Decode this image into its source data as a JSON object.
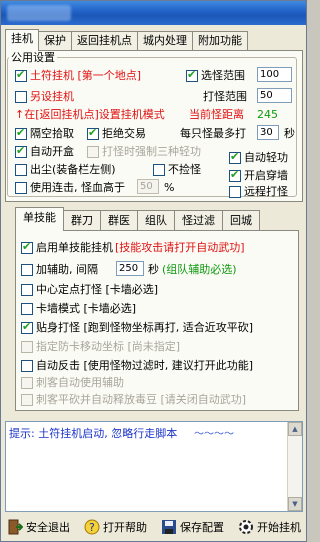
{
  "tabs": [
    "挂机",
    "保护",
    "返回挂机点",
    "城内处理",
    "附加功能"
  ],
  "group_title": "公用设置",
  "opts": {
    "tufu": "土符挂机 [第一个地点]",
    "select_range": "选怪范围",
    "select_range_val": "100",
    "alt_hang": "另设挂机",
    "hit_range": "打怪范围",
    "hit_range_val": "50",
    "hint_return": "↑在[返回挂机点]设置挂机模式",
    "cur_dist_label": "当前怪距离",
    "cur_dist_val": "245",
    "pickup": "隔空拾取",
    "refuse": "拒绝交易",
    "max_time_label": "每只怪最多打",
    "max_time_val": "30",
    "max_time_unit": "秒",
    "auto_box": "自动开盒",
    "force_skill": "打怪时强制三种轻功",
    "sell": "出尘(装备栏左侧)",
    "no_pick": "不捡怪",
    "auto_light": "自动轻功",
    "wall": "开启穿墙",
    "combo": "使用连击, 怪血高于",
    "combo_val": "50",
    "combo_unit": "%",
    "remote_hit": "远程打怪"
  },
  "tabs2": [
    "单技能",
    "群刀",
    "群医",
    "组队",
    "怪过滤",
    "回城"
  ],
  "skill": {
    "single": "启用单技能挂机",
    "single_note": "[技能攻击请打开自动武功]",
    "assist": "加辅助, 间隔",
    "assist_val": "250",
    "assist_unit": "秒",
    "assist_note": "(组队辅助必选)",
    "center": "中心定点打怪 [卡墙必选]",
    "stuck": "卡墙模式 [卡墙必选]",
    "close": "贴身打怪 [跑到怪物坐标再打, 适合近攻平砍]",
    "guard": "指定防卡移动坐标 [尚未指定]",
    "counter": "自动反击 [使用怪物过滤时, 建议打开此功能]",
    "assassin": "刺客自动使用辅助",
    "assassin2": "刺客平砍并自动释放毒豆 [请关闭自动武功]"
  },
  "log_text": "提示: 土符挂机启动, 忽略行走脚本",
  "buttons": {
    "exit": "安全退出",
    "help": "打开帮助",
    "save": "保存配置",
    "start": "开始挂机"
  },
  "colors": {
    "accent_red": "#e01010",
    "accent_green": "#109a10",
    "title_blue": "#2264c9"
  }
}
